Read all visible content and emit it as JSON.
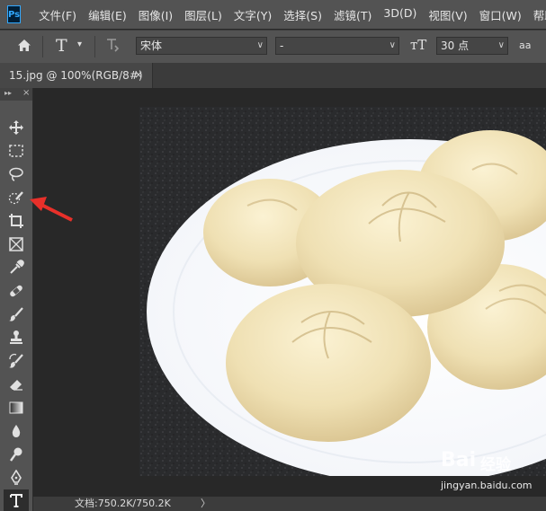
{
  "app": {
    "logo": "Ps"
  },
  "menu": [
    "文件(F)",
    "编辑(E)",
    "图像(I)",
    "图层(L)",
    "文字(Y)",
    "选择(S)",
    "滤镜(T)",
    "3D(D)",
    "视图(V)",
    "窗口(W)",
    "帮助"
  ],
  "options": {
    "home_icon": "home-icon",
    "type_tool_icon": "horizontal-type-icon",
    "orientation_icon": "text-orientation-icon",
    "font_family": "宋体",
    "font_style": "-",
    "font_size": "30 点",
    "size_icon": "font-size-icon",
    "antialias_label": "aa"
  },
  "document_tab": {
    "title": "15.jpg @ 100%(RGB/8#)",
    "close": "×"
  },
  "toolbar": {
    "collapse": "▸▸",
    "close": "×",
    "tools": [
      {
        "name": "move-tool",
        "icon": "move-icon"
      },
      {
        "name": "marquee-tool",
        "icon": "rect-marquee-icon"
      },
      {
        "name": "lasso-tool",
        "icon": "lasso-icon"
      },
      {
        "name": "quick-selection-tool",
        "icon": "quick-selection-icon"
      },
      {
        "name": "crop-tool",
        "icon": "crop-icon"
      },
      {
        "name": "frame-tool",
        "icon": "frame-icon"
      },
      {
        "name": "eyedropper-tool",
        "icon": "eyedropper-icon"
      },
      {
        "name": "healing-brush-tool",
        "icon": "bandage-icon"
      },
      {
        "name": "brush-tool",
        "icon": "brush-icon"
      },
      {
        "name": "clone-stamp-tool",
        "icon": "stamp-icon"
      },
      {
        "name": "history-brush-tool",
        "icon": "history-brush-icon"
      },
      {
        "name": "eraser-tool",
        "icon": "eraser-icon"
      },
      {
        "name": "gradient-tool",
        "icon": "gradient-icon"
      },
      {
        "name": "blur-tool",
        "icon": "drop-icon"
      },
      {
        "name": "dodge-tool",
        "icon": "dodge-icon"
      },
      {
        "name": "pen-tool",
        "icon": "pen-icon"
      },
      {
        "name": "type-tool",
        "icon": "type-icon"
      }
    ],
    "active_tool": "type-tool"
  },
  "annotation": {
    "color": "#e8302a",
    "points_to": "quick-selection-tool"
  },
  "status": {
    "doc_info": "文档:750.2K/750.2K",
    "arrow": "〉"
  },
  "watermark": {
    "logo": "Bai",
    "brand": "经验",
    "url": "jingyan.baidu.com"
  },
  "colors": {
    "chrome": "#535353",
    "dark": "#282828",
    "accent": "#31a8ff"
  }
}
